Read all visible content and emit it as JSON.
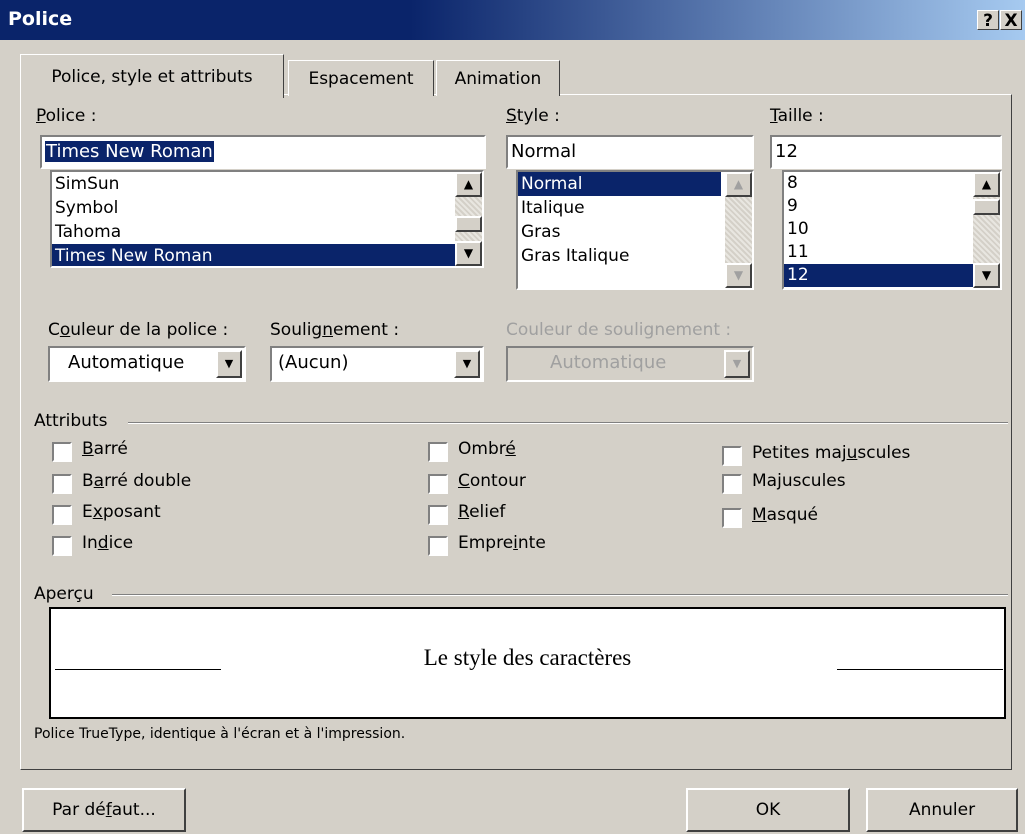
{
  "window": {
    "title": "Police",
    "help_label": "?",
    "close_label": "X"
  },
  "tabs": [
    {
      "label": "Police, style et attributs",
      "active": true
    },
    {
      "label": "Espacement",
      "active": false
    },
    {
      "label": "Animation",
      "active": false
    }
  ],
  "font": {
    "label_mnemonic": "P",
    "label_rest": "olice :",
    "value": "Times New Roman",
    "items": [
      {
        "label": "SimSun",
        "selected": false
      },
      {
        "label": "Symbol",
        "selected": false
      },
      {
        "label": "Tahoma",
        "selected": false
      },
      {
        "label": "Times New Roman",
        "selected": true
      }
    ]
  },
  "style": {
    "label_mnemonic": "S",
    "label_rest": "tyle :",
    "value": "Normal",
    "items": [
      {
        "label": "Normal",
        "selected": true
      },
      {
        "label": "Italique",
        "selected": false
      },
      {
        "label": "Gras",
        "selected": false
      },
      {
        "label": "Gras Italique",
        "selected": false
      }
    ]
  },
  "size": {
    "label_mnemonic": "T",
    "label_rest": "aille :",
    "value": "12",
    "items": [
      {
        "label": "8",
        "selected": false
      },
      {
        "label": "9",
        "selected": false
      },
      {
        "label": "10",
        "selected": false
      },
      {
        "label": "11",
        "selected": false
      },
      {
        "label": "12",
        "selected": true
      }
    ]
  },
  "font_color": {
    "label_pre": "C",
    "label_mnemonic": "o",
    "label_rest": "uleur de la police :",
    "value": "Automatique"
  },
  "underline": {
    "label_pre": "Soulig",
    "label_mnemonic": "n",
    "label_rest": "ement :",
    "value": "(Aucun)"
  },
  "underline_color": {
    "label": "Couleur de soulignement :",
    "value": "Automatique",
    "disabled": true
  },
  "attributes": {
    "title": "Attributs",
    "items": [
      {
        "pre": "",
        "mn": "B",
        "post": "arré",
        "checked": false
      },
      {
        "pre": "B",
        "mn": "a",
        "post": "rré double",
        "checked": false
      },
      {
        "pre": "E",
        "mn": "x",
        "post": "posant",
        "checked": false
      },
      {
        "pre": "In",
        "mn": "d",
        "post": "ice",
        "checked": false
      },
      {
        "pre": "Ombr",
        "mn": "é",
        "post": "",
        "checked": false
      },
      {
        "pre": "",
        "mn": "C",
        "post": "ontour",
        "checked": false
      },
      {
        "pre": "",
        "mn": "R",
        "post": "elief",
        "checked": false
      },
      {
        "pre": "Empre",
        "mn": "i",
        "post": "nte",
        "checked": false
      },
      {
        "pre": "Petites maj",
        "mn": "u",
        "post": "scules",
        "checked": false
      },
      {
        "pre": "Ma",
        "mn": "j",
        "post": "uscules",
        "checked": false
      },
      {
        "pre": "",
        "mn": "M",
        "post": "asqué",
        "checked": false
      }
    ]
  },
  "preview": {
    "title": "Aperçu",
    "sample_text": "Le style des caractères"
  },
  "info_text": "Police TrueType, identique à l'écran et à l'impression.",
  "buttons": {
    "default_pre": "Par dé",
    "default_mn": "f",
    "default_post": "aut...",
    "ok": "OK",
    "cancel": "Annuler"
  },
  "colors": {
    "title_bar": "#0a246a",
    "selection": "#0a246a",
    "face": "#d4d0c8"
  }
}
